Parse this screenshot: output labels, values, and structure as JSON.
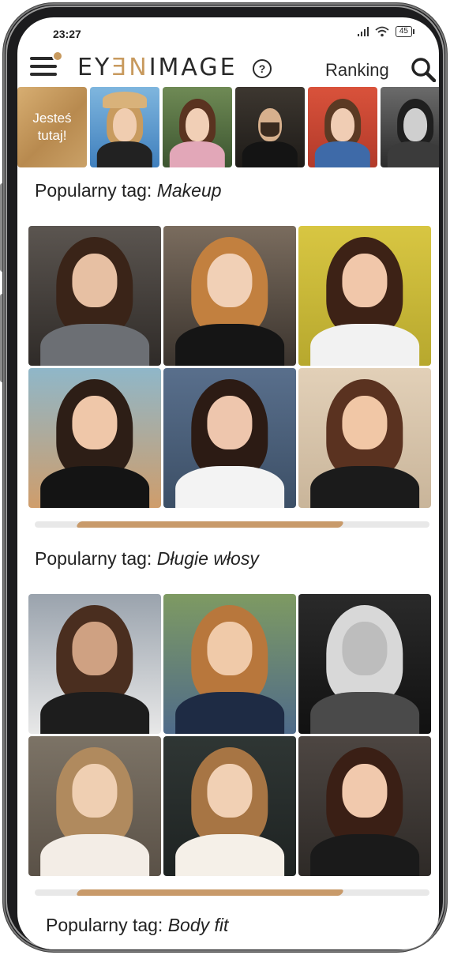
{
  "status_bar": {
    "time": "23:27",
    "battery": "45"
  },
  "header": {
    "logo_prefix": "EY",
    "logo_accent": "ƎN",
    "logo_suffix": "IMAGE",
    "help_symbol": "?",
    "ranking_label": "Ranking"
  },
  "stories": {
    "here_label_line1": "Jesteś",
    "here_label_line2": "tutaj!"
  },
  "sections": [
    {
      "prefix": "Popularny tag: ",
      "tag": "Makeup"
    },
    {
      "prefix": "Popularny tag: ",
      "tag": "Długie włosy"
    },
    {
      "prefix": "Popularny tag: ",
      "tag": "Body fit"
    }
  ],
  "colors": {
    "accent": "#c89a5e",
    "text": "#222222",
    "frame": "#1c1c1e"
  },
  "icons": {
    "menu": "hamburger-icon",
    "help": "help-icon",
    "search": "search-icon"
  },
  "scroll_progress": {
    "makeup_row": 0.5,
    "dlugie_row": 0.5
  }
}
